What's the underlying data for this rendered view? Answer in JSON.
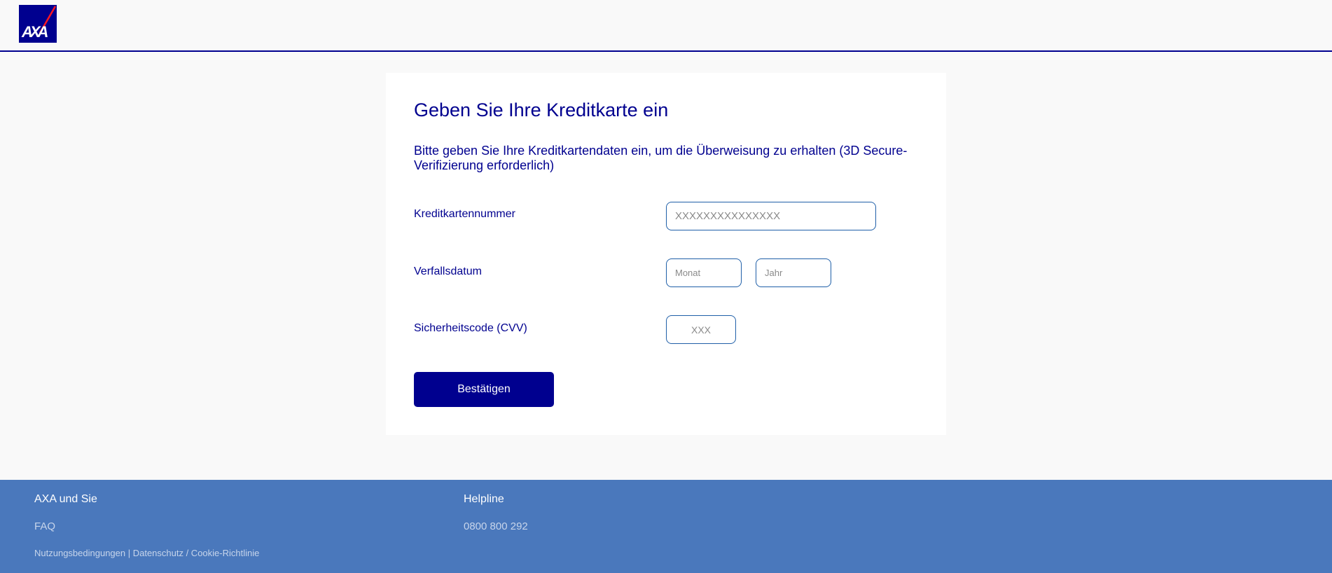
{
  "header": {
    "logo_text": "AXA"
  },
  "form": {
    "title": "Geben Sie Ihre Kreditkarte ein",
    "subtitle": "Bitte geben Sie Ihre Kreditkartendaten ein, um die Überweisung zu erhalten (3D Secure-Verifizierung erforderlich)",
    "card_number": {
      "label": "Kreditkartennummer",
      "placeholder": "XXXXXXXXXXXXXXX",
      "value": ""
    },
    "expiry": {
      "label": "Verfallsdatum",
      "month_placeholder": "Monat",
      "year_placeholder": "Jahr"
    },
    "cvv": {
      "label": "Sicherheitscode (CVV)",
      "placeholder": "XXX"
    },
    "submit_label": "Bestätigen"
  },
  "footer": {
    "col1_heading": "AXA und Sie",
    "faq_label": "FAQ",
    "legal_label": "Nutzungsbedingungen | Datenschutz / Cookie-Richtlinie",
    "col2_heading": "Helpline",
    "phone": "0800 800 292"
  },
  "colors": {
    "brand": "#00008f",
    "footer_bg": "#4a78bc",
    "input_border": "#1f5fa8"
  }
}
